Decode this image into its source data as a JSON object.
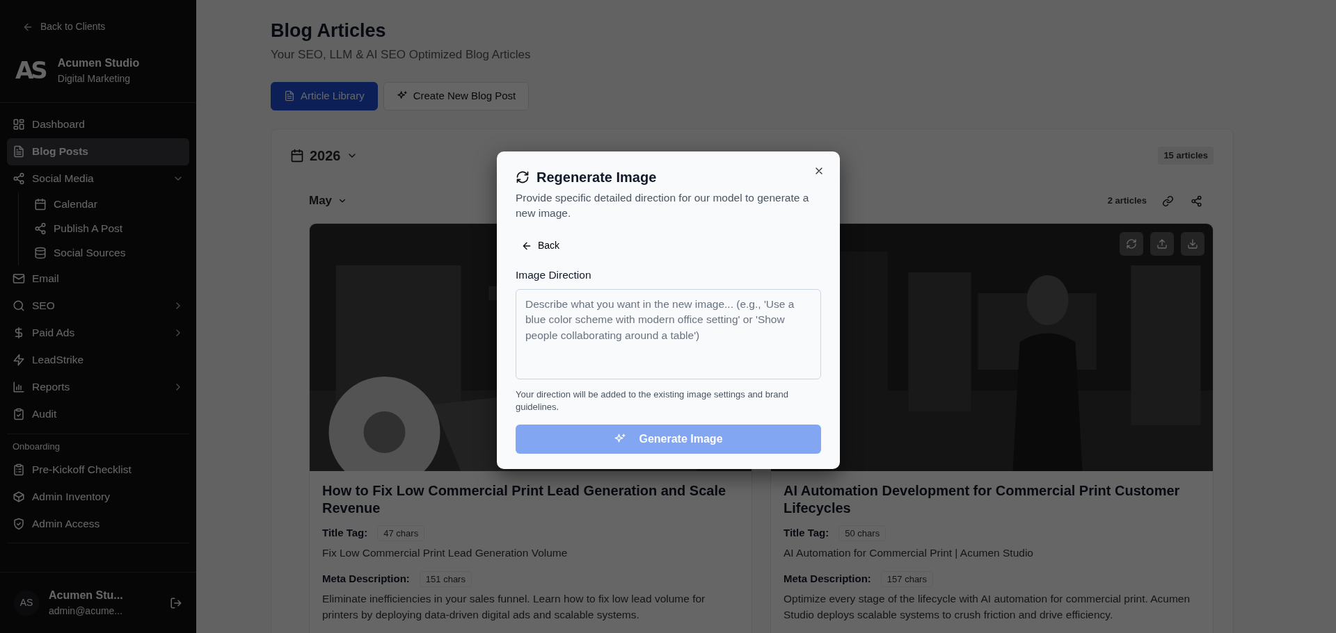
{
  "sidebar": {
    "back_link": "Back to Clients",
    "brand": {
      "logo": "AS",
      "name": "Acumen Studio",
      "subtitle": "Digital Marketing"
    },
    "items": [
      {
        "label": "Dashboard",
        "selected": false
      },
      {
        "label": "Blog Posts",
        "selected": true
      },
      {
        "label": "Social Media",
        "selected": false,
        "expanded": true,
        "children": [
          {
            "label": "Calendar",
            "selected": false
          },
          {
            "label": "Publish A Post",
            "selected": false
          },
          {
            "label": "Social Sources",
            "selected": false
          }
        ]
      },
      {
        "label": "Email",
        "selected": false
      },
      {
        "label": "SEO",
        "selected": false,
        "expanded": false
      },
      {
        "label": "Paid Ads",
        "selected": false,
        "expanded": false
      },
      {
        "label": "LeadStrike",
        "selected": false
      },
      {
        "label": "Reports",
        "selected": false,
        "expanded": false
      },
      {
        "label": "Audit",
        "selected": false
      }
    ],
    "section": {
      "title": "Onboarding",
      "items": [
        {
          "label": "Pre-Kickoff Checklist",
          "selected": false
        },
        {
          "label": "Admin Inventory",
          "selected": false
        },
        {
          "label": "Admin Access",
          "selected": false
        }
      ]
    },
    "user": {
      "initials": "AS",
      "name": "Acumen Stu...",
      "email": "admin@acume..."
    }
  },
  "page": {
    "title": "Blog Articles",
    "subtitle": "Your SEO, LLM & AI SEO Optimized Blog Articles",
    "tabs": [
      {
        "label": "Article Library",
        "selected": true
      },
      {
        "label": "Create New Blog Post",
        "selected": false
      }
    ],
    "year": {
      "label": "2026",
      "count": "15 articles"
    },
    "month": {
      "label": "May",
      "count": "2 articles"
    },
    "articles": [
      {
        "hovered": false,
        "title": "How to Fix Low Commercial Print Lead Generation and Scale Revenue",
        "title_tag_label": "Title Tag:",
        "title_tag_count": "47 chars",
        "title_tag": "Fix Low Commercial Print Lead Generation Volume",
        "meta_label": "Meta Description:",
        "meta_count": "151 chars",
        "meta": "Eliminate inefficiencies in your sales funnel. Learn how to fix low lead volume for printers by deploying data-driven digital ads and scalable systems."
      },
      {
        "hovered": true,
        "title": "AI Automation Development for Commercial Print Customer Lifecycles",
        "title_tag_label": "Title Tag:",
        "title_tag_count": "50 chars",
        "title_tag": "AI Automation for Commercial Print | Acumen Studio",
        "meta_label": "Meta Description:",
        "meta_count": "157 chars",
        "meta": "Optimize every stage of the lifecycle with AI automation for commercial print. Acumen Studio deploys scalable systems to crush friction and drive efficiency."
      }
    ]
  },
  "modal": {
    "title": "Regenerate Image",
    "description": "Provide specific detailed direction for our model to generate a new image.",
    "back": "Back",
    "field_label": "Image Direction",
    "placeholder": "Describe what you want in the new image... (e.g., 'Use a blue color scheme with modern office setting' or 'Show people collaborating around a table')",
    "hint": "Your direction will be added to the existing image settings and brand guidelines.",
    "button": {
      "label": "Generate Image",
      "disabled": true
    }
  }
}
